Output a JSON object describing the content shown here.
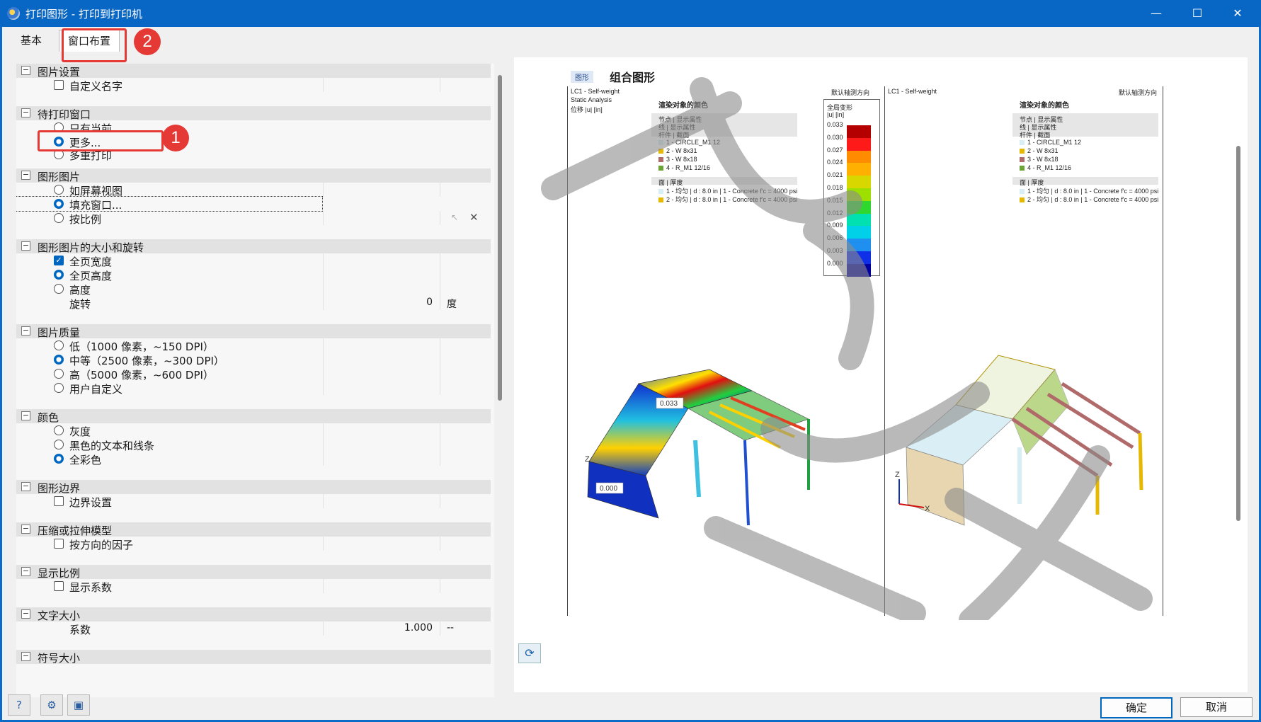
{
  "window": {
    "title": "打印图形 - 打印到打印机",
    "minimize": "—",
    "maximize": "☐",
    "close": "✕"
  },
  "tabs": [
    {
      "label": "基本"
    },
    {
      "label": "窗口布置"
    }
  ],
  "callouts": [
    "1",
    "2"
  ],
  "sections": {
    "image_settings": {
      "title": "图片设置",
      "custom_name": "自定义名字"
    },
    "print_windows": {
      "title": "待打印窗口",
      "only_current": "只有当前",
      "more": "更多...",
      "multiple": "多重打印"
    },
    "graphic_image": {
      "title": "图形图片",
      "as_screen": "如屏幕视图",
      "fill_window": "填充窗口...",
      "by_scale": "按比例"
    },
    "size_rotation": {
      "title": "图形图片的大小和旋转",
      "full_width": "全页宽度",
      "full_height": "全页高度",
      "height": "高度",
      "rotation": "旋转",
      "rotation_value": "0",
      "rotation_unit": "度"
    },
    "quality": {
      "title": "图片质量",
      "low": "低（1000 像素，~150 DPI）",
      "medium": "中等（2500 像素，~300 DPI）",
      "high": "高（5000 像素，~600 DPI）",
      "user": "用户自定义"
    },
    "color": {
      "title": "颜色",
      "gray": "灰度",
      "black_text": "黑色的文本和线条",
      "full_color": "全彩色"
    },
    "border": {
      "title": "图形边界",
      "border_settings": "边界设置"
    },
    "compression": {
      "title": "压缩或拉伸模型",
      "factor": "按方向的因子"
    },
    "display_scale": {
      "title": "显示比例",
      "show_factor": "显示系数"
    },
    "text_size": {
      "title": "文字大小",
      "factor": "系数",
      "factor_value": "1.000",
      "factor_unit": "--"
    },
    "symbol_size": {
      "title": "符号大小"
    }
  },
  "preview": {
    "badge": "图形",
    "title": "组合图形",
    "left": {
      "lc": "LC1 - Self-weight",
      "analysis": "Static Analysis",
      "disp": "位移 |u| [in]",
      "view": "默认轴测方向",
      "legend_title": "渲染对象的颜色",
      "legend_rows": [
        "节点 | 显示属性",
        "线 | 显示属性",
        "杆件 | 截面"
      ],
      "members": [
        {
          "label": "1 - CIRCLE_M1 12",
          "color": "#d7eef5"
        },
        {
          "label": "2 - W 8x31",
          "color": "#e6b800"
        },
        {
          "label": "3 - W 8x18",
          "color": "#b06a6a"
        },
        {
          "label": "4 - R_M1 12/16",
          "color": "#6aa336"
        }
      ],
      "surface_title": "面 | 厚度",
      "surfaces": [
        {
          "label": "1 - 均匀 | d : 8.0 in | 1 - Concrete f'c = 4000 psi",
          "color": "#d7eef5"
        },
        {
          "label": "2 - 均匀 | d : 8.0 in | 1 - Concrete f'c = 4000 psi",
          "color": "#e6b800"
        }
      ],
      "scale_title": "全局变形",
      "scale_unit": "|u| [in]",
      "scale_values": [
        "0.033",
        "0.030",
        "0.027",
        "0.024",
        "0.021",
        "0.018",
        "0.015",
        "0.012",
        "0.009",
        "0.006",
        "0.003",
        "0.000"
      ],
      "scale_colors": [
        "#b40000",
        "#ff1a1a",
        "#ff8c00",
        "#ffb000",
        "#d8d800",
        "#9de000",
        "#2fd82f",
        "#00e0b0",
        "#00d0e8",
        "#2090f0",
        "#1030e8",
        "#0000a0"
      ],
      "annot_max": "0.033",
      "annot_min": "0.000",
      "axis_z": "Z"
    },
    "right": {
      "lc": "LC1 - Self-weight",
      "view": "默认轴测方向",
      "legend_title": "渲染对象的颜色",
      "legend_rows": [
        "节点 | 显示属性",
        "线 | 显示属性",
        "杆件 | 截面"
      ],
      "members": [
        {
          "label": "1 - CIRCLE_M1 12",
          "color": "#d7eef5"
        },
        {
          "label": "2 - W 8x31",
          "color": "#e6b800"
        },
        {
          "label": "3 - W 8x18",
          "color": "#b06a6a"
        },
        {
          "label": "4 - R_M1 12/16",
          "color": "#6aa336"
        }
      ],
      "surface_title": "面 | 厚度",
      "surfaces": [
        {
          "label": "1 - 均匀 | d : 8.0 in | 1 - Concrete f'c = 4000 psi",
          "color": "#d7eef5"
        },
        {
          "label": "2 - 均匀 | d : 8.0 in | 1 - Concrete f'c = 4000 psi",
          "color": "#e6b800"
        }
      ],
      "axis_z": "Z",
      "axis_x": "X"
    }
  },
  "buttons": {
    "ok": "确定",
    "cancel": "取消"
  }
}
